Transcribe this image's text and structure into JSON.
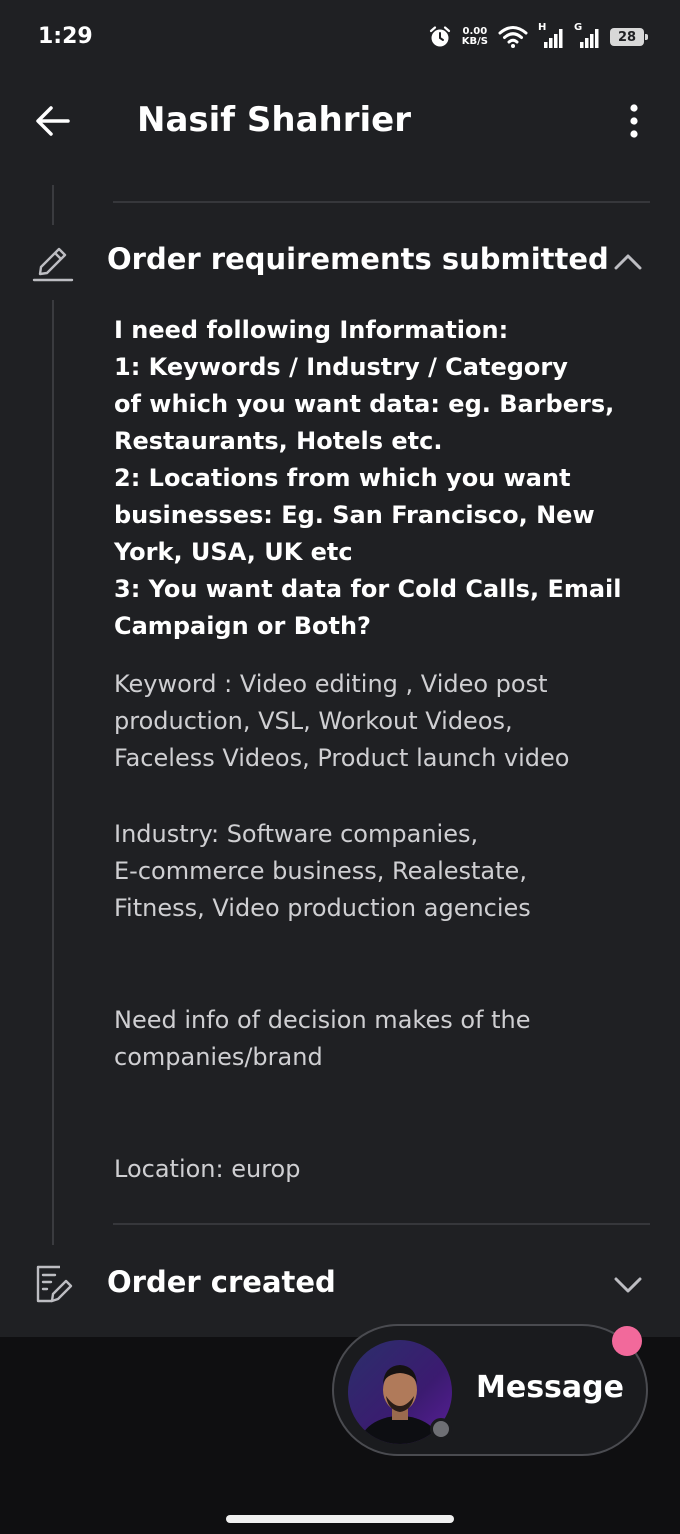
{
  "status_bar": {
    "time": "1:29",
    "net_speed_value": "0.00",
    "net_speed_unit": "KB/S",
    "signal1_label": "H",
    "signal2_label": "G",
    "battery_level": "28",
    "icons": [
      "alarm-icon",
      "wifi-icon",
      "signal-icon",
      "battery-icon"
    ]
  },
  "header": {
    "title": "Nasif Shahrier",
    "back_icon": "arrow-left-icon",
    "menu_icon": "more-vertical-icon"
  },
  "sections": {
    "requirements": {
      "title": "Order requirements submitted",
      "icon": "pencil-icon",
      "expanded": true,
      "question_lines": [
        "I need following Information:",
        "1: Keywords / Industry / Category",
        "of which you want data: eg. Barbers,",
        "Restaurants, Hotels etc.",
        "2: Locations from which you want",
        "businesses:  Eg. San Francisco, New",
        "York, USA, UK etc",
        "3: You want data for Cold Calls, Email",
        "Campaign or Both?"
      ],
      "answer_keyword_lines": [
        "Keyword : Video editing , Video post",
        "production, VSL, Workout Videos,",
        "Faceless Videos, Product launch video"
      ],
      "answer_industry_lines": [
        "Industry: Software companies,",
        "E-commerce business, Realestate,",
        "Fitness, Video production agencies"
      ],
      "answer_info_lines": [
        "Need info of decision makes of the",
        "companies/brand"
      ],
      "answer_location": "Location: europ"
    },
    "created": {
      "title": "Order created",
      "icon": "order-edit-icon",
      "expanded": false
    }
  },
  "message_button": {
    "label": "Message",
    "status": "offline",
    "notification_color": "#f2699b"
  },
  "colors": {
    "background": "#1f2023",
    "text_primary": "#ffffff",
    "text_secondary": "#cfcfd2"
  }
}
